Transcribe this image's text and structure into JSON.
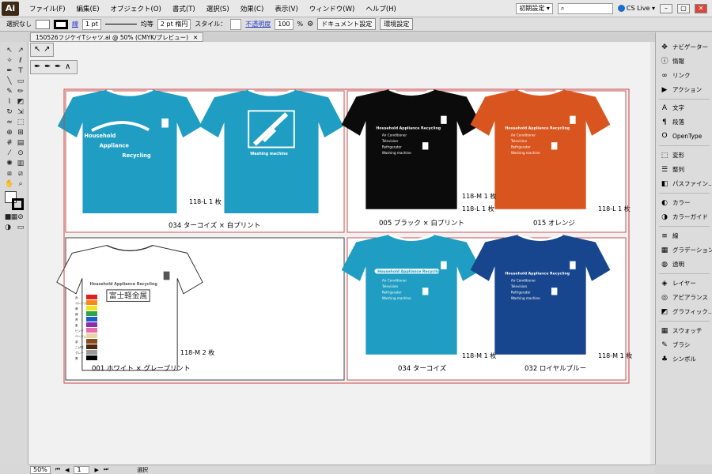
{
  "app": {
    "logo": "Ai"
  },
  "menu": [
    "ファイル(F)",
    "編集(E)",
    "オブジェクト(O)",
    "書式(T)",
    "選択(S)",
    "効果(C)",
    "表示(V)",
    "ウィンドウ(W)",
    "ヘルプ(H)"
  ],
  "topright": {
    "workspace": "初期設定 ▾",
    "cslive": "CS Live ▾"
  },
  "control": {
    "selection": "選択なし",
    "stroke_label": "線",
    "stroke_value": "1 pt",
    "profile": "均等",
    "brush": "2 pt 楕円",
    "style_label": "スタイル：",
    "opacity_label": "不透明度",
    "opacity_value": "100",
    "opacity_unit": "%",
    "doc_settings": "ドキュメント設定",
    "prefs": "環境設定"
  },
  "document_tab": {
    "title": "150526フジケイTシャツ.ai @ 50% (CMYK/プレビュー)"
  },
  "cards": [
    {
      "caption": "034 ターコイズ × 白プリント",
      "counts": [
        "118-L 1 枚"
      ]
    },
    {
      "caption": "005 ブラック × 白プリント",
      "counts": [
        "118-M 1 枚",
        "118-L 1 枚"
      ],
      "caption2": "015 オレンジ",
      "counts2": [
        "118-L 1 枚"
      ]
    },
    {
      "caption": "001 ホワイト × グレープリント",
      "counts": [
        "118-M 2 枚"
      ]
    },
    {
      "caption": "034 ターコイズ",
      "counts": [
        "118-M 1 枚"
      ],
      "caption2": "032 ロイヤルブルー",
      "counts2": [
        "118-M 1 枚"
      ]
    }
  ],
  "shirt_print": {
    "hh1": "Household",
    "hh2": "Appliance",
    "hh3": "Recycling",
    "hh_line": "Household Appliance Recycling",
    "items": [
      "Air Conditioner",
      "Television",
      "Refrigerator",
      "Washing machine"
    ],
    "kanji": "富士軽金属"
  },
  "swatch_labels": [
    "赤",
    "オレンジ",
    "黄",
    "緑",
    "青",
    "紫",
    "ピンク",
    "ベージュ",
    "茶",
    "こげ茶",
    "グレー",
    "黒"
  ],
  "colors": {
    "turquoise": "#1f9dc2",
    "black": "#0b0b0b",
    "orange": "#d9551f",
    "white": "#ffffff",
    "royal": "#17468f"
  },
  "panels": [
    {
      "label": "ナビゲーター",
      "icon": "navigator-icon"
    },
    {
      "label": "情報",
      "icon": "info-icon"
    },
    {
      "label": "リンク",
      "icon": "links-icon"
    },
    {
      "label": "アクション",
      "icon": "actions-icon"
    },
    {
      "label": "文字",
      "icon": "character-icon"
    },
    {
      "label": "段落",
      "icon": "paragraph-icon"
    },
    {
      "label": "OpenType",
      "icon": "opentype-icon"
    },
    {
      "label": "変形",
      "icon": "transform-icon"
    },
    {
      "label": "整列",
      "icon": "align-icon"
    },
    {
      "label": "パスファイン...",
      "icon": "pathfinder-icon"
    },
    {
      "label": "カラー",
      "icon": "color-icon"
    },
    {
      "label": "カラーガイド",
      "icon": "color-guide-icon"
    },
    {
      "label": "線",
      "icon": "stroke-icon"
    },
    {
      "label": "グラデーション",
      "icon": "gradient-icon"
    },
    {
      "label": "透明",
      "icon": "transparency-icon"
    },
    {
      "label": "レイヤー",
      "icon": "layers-icon"
    },
    {
      "label": "アピアランス",
      "icon": "appearance-icon"
    },
    {
      "label": "グラフィック...",
      "icon": "graphic-styles-icon"
    },
    {
      "label": "スウォッチ",
      "icon": "swatches-icon"
    },
    {
      "label": "ブラシ",
      "icon": "brushes-icon"
    },
    {
      "label": "シンボル",
      "icon": "symbols-icon"
    }
  ],
  "status": {
    "zoom": "50%",
    "page": "1",
    "mode": "選択"
  }
}
